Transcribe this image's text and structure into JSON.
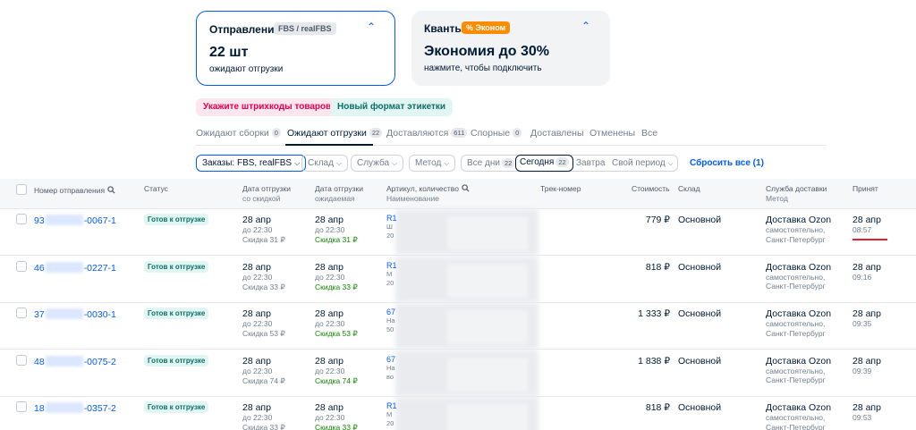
{
  "cards": {
    "shipments": {
      "title": "Отправления",
      "tag": "FBS / realFBS",
      "big": "22 шт",
      "sub": "ожидают отгрузки"
    },
    "kvanty": {
      "title": "Кванты",
      "tag": "% Эконом",
      "big": "Экономия до 30%",
      "sub": "нажмите, чтобы подключить"
    }
  },
  "pills": {
    "barcodes": "Укажите штрихкоды товаров",
    "new_format": "Новый формат этикетки"
  },
  "tabs": [
    {
      "label": "Ожидают сборки",
      "count": "0"
    },
    {
      "label": "Ожидают отгрузки",
      "count": "22"
    },
    {
      "label": "Доставляются",
      "count": "611"
    },
    {
      "label": "Спорные",
      "count": "0"
    },
    {
      "label": "Доставлены",
      "count": ""
    },
    {
      "label": "Отменены",
      "count": ""
    },
    {
      "label": "Все",
      "count": ""
    }
  ],
  "filters": {
    "orders": "Заказы: FBS, realFBS",
    "warehouse": "Склад",
    "service": "Служба",
    "method": "Метод",
    "all_days": "Все дни",
    "all_days_count": "22",
    "today": "Сегодня",
    "today_count": "22",
    "tomorrow": "Завтра",
    "custom_period": "Свой период",
    "reset": "Сбросить все (1)"
  },
  "table": {
    "headers": {
      "number": "Номер отправления",
      "status": "Статус",
      "ship_date": "Дата отгрузки",
      "ship_date_sub": "со скидкой",
      "ship_date_exp": "Дата отгрузки",
      "ship_date_exp_sub": "ожидаемая",
      "article": "Артикул, количество",
      "article_sub": "Наименование",
      "track": "Трек-номер",
      "cost": "Стоимость",
      "warehouse": "Склад",
      "delivery": "Служба доставки",
      "delivery_sub": "Метод",
      "accepted": "Принят"
    },
    "rows": [
      {
        "num_a": "93",
        "num_b": "-0067-1",
        "status": "Готов к отгрузке",
        "d1": "28 апр",
        "d1t": "до 22:30",
        "d1s": "Скидка 31 ₽",
        "d2": "28 апр",
        "d2t": "до 22:30",
        "d2s": "Скидка 31 ₽",
        "art": "R1",
        "art_sub": "Ш",
        "art_sub2": "20",
        "price": "779 ₽",
        "sklad": "Основной",
        "dlv": "Доставка Ozon",
        "dlv1": "самостоятельно,",
        "dlv2": "Санкт-Петербург",
        "acc": "28 апр",
        "acc_t": "08:57"
      },
      {
        "num_a": "46",
        "num_b": "-0227-1",
        "status": "Готов к отгрузке",
        "d1": "28 апр",
        "d1t": "до 22:30",
        "d1s": "Скидка 33 ₽",
        "d2": "28 апр",
        "d2t": "до 22:30",
        "d2s": "Скидка 33 ₽",
        "art": "R1",
        "art_sub": "М",
        "art_sub2": "20",
        "price": "818 ₽",
        "sklad": "Основной",
        "dlv": "Доставка Ozon",
        "dlv1": "самостоятельно,",
        "dlv2": "Санкт-Петербург",
        "acc": "28 апр",
        "acc_t": "09:16"
      },
      {
        "num_a": "37",
        "num_b": "-0030-1",
        "status": "Готов к отгрузке",
        "d1": "28 апр",
        "d1t": "до 22:30",
        "d1s": "Скидка 53 ₽",
        "d2": "28 апр",
        "d2t": "до 22:30",
        "d2s": "Скидка 53 ₽",
        "art": "67",
        "art_sub": "На",
        "art_sub2": "50",
        "price": "1 333 ₽",
        "sklad": "Основной",
        "dlv": "Доставка Ozon",
        "dlv1": "самостоятельно,",
        "dlv2": "Санкт-Петербург",
        "acc": "28 апр",
        "acc_t": "09:35"
      },
      {
        "num_a": "48",
        "num_b": "-0075-2",
        "status": "Готов к отгрузке",
        "d1": "28 апр",
        "d1t": "до 22:30",
        "d1s": "Скидка 74 ₽",
        "d2": "28 апр",
        "d2t": "до 22:30",
        "d2s": "Скидка 74 ₽",
        "art": "67",
        "art_sub": "На",
        "art_sub2": "во",
        "price": "1 838 ₽",
        "sklad": "Основной",
        "dlv": "Доставка Ozon",
        "dlv1": "самостоятельно,",
        "dlv2": "Санкт-Петербург",
        "acc": "28 апр",
        "acc_t": "09:39"
      },
      {
        "num_a": "18",
        "num_b": "-0357-2",
        "status": "Готов к отгрузке",
        "d1": "28 апр",
        "d1t": "до 22:30",
        "d1s": "Скидка 33 ₽",
        "d2": "28 апр",
        "d2t": "до 22:30",
        "d2s": "Скидка 33 ₽",
        "art": "R1",
        "art_sub": "М",
        "art_sub2": "20",
        "price": "818 ₽",
        "sklad": "Основной",
        "dlv": "Доставка Ozon",
        "dlv1": "самостоятельно,",
        "dlv2": "Санкт-Петербург",
        "acc": "28 апр",
        "acc_t": "09:53"
      }
    ]
  },
  "colors": {
    "accent": "#005bff",
    "status_bg": "#e1f5f2",
    "status_text": "#0b6f67",
    "discount": "#108a00",
    "highlight": "#e6202f"
  },
  "icons": {
    "chevron_up": "chevron-up-icon",
    "search": "search-icon",
    "chevron_down": "chevron-down-icon"
  }
}
